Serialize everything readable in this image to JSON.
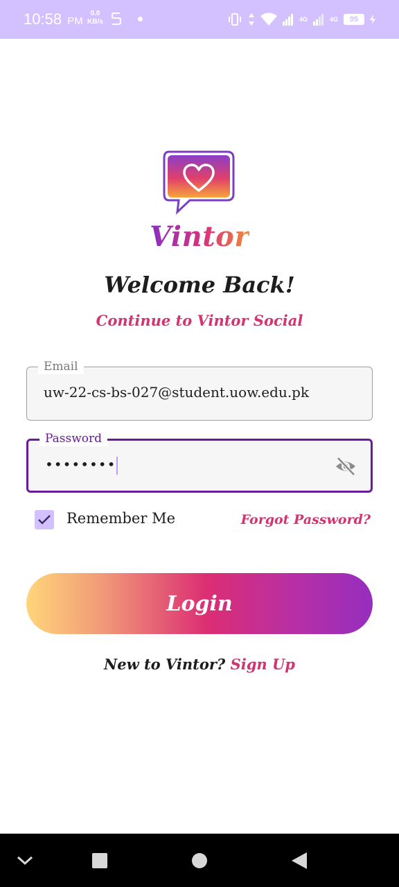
{
  "status_bar": {
    "time": "10:58",
    "ampm": "PM",
    "speed_value": "0.0",
    "speed_unit": "KB/s",
    "network_1": "4G",
    "network_2": "4G",
    "battery": "95",
    "background_color": "#d3c1ff"
  },
  "app": {
    "brand_name": "Vintor",
    "welcome_title": "Welcome Back!",
    "subtitle": "Continue to Vintor Social",
    "accent_color": "#d3336f",
    "primary_color": "#6a1b9a"
  },
  "form": {
    "email_label": "Email",
    "email_value": "uw-22-cs-bs-027@student.uow.edu.pk",
    "password_label": "Password",
    "password_value": "••••••••",
    "remember_label": "Remember Me",
    "remember_checked": true,
    "forgot_label": "Forgot Password?",
    "login_label": "Login"
  },
  "footer": {
    "signup_prompt": "New to Vintor?",
    "signup_link": "Sign Up"
  },
  "nav": {
    "items": [
      "chevron-down-icon",
      "recent-apps-icon",
      "home-icon",
      "back-icon"
    ]
  }
}
